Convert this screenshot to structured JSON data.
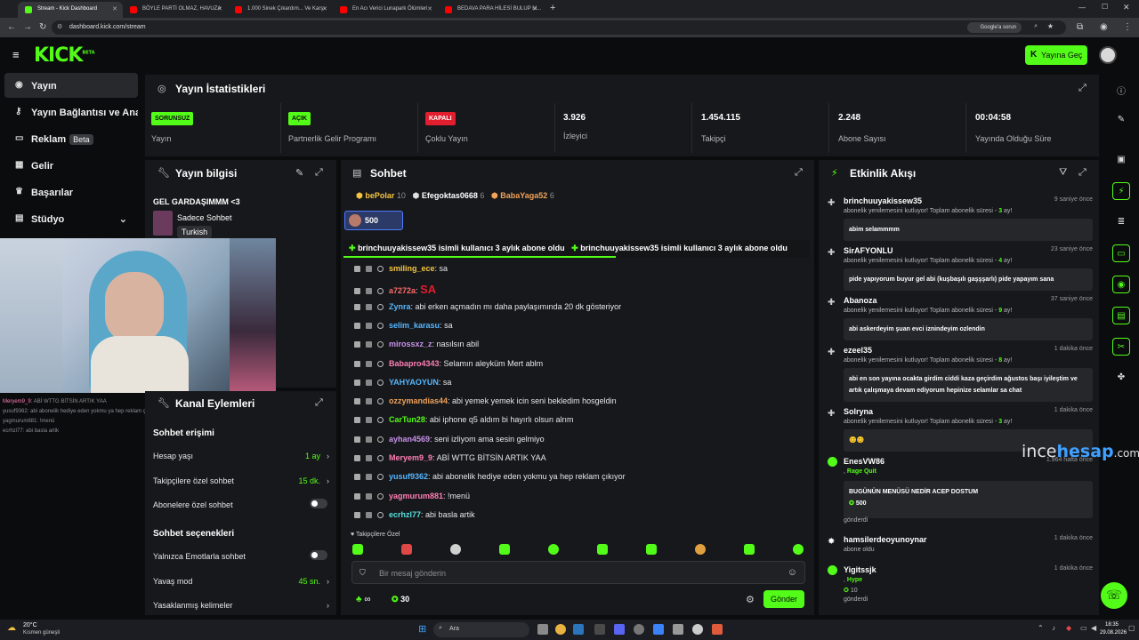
{
  "browser": {
    "tabs": [
      {
        "title": "Stream - Kick Dashboard",
        "active": true,
        "color": "#53fc18"
      },
      {
        "title": "BÖYLE PARTİ OLMAZ, HAVUZA",
        "active": false,
        "color": "#ff0000"
      },
      {
        "title": "1.000 Sinek Çıkardım... Ve Karşı",
        "active": false,
        "color": "#ff0000"
      },
      {
        "title": "En Acı Verici Lunapark Ölümleri",
        "active": false,
        "color": "#ff0000"
      },
      {
        "title": "BEDAVA PARA HİLESİ BULUP M...",
        "active": false,
        "color": "#ff0000"
      }
    ],
    "new_tab": "+",
    "url": "dashboard.kick.com/stream",
    "google_issue": "Google'a sorun"
  },
  "header": {
    "logo": "KICK",
    "logo_sup": "BETA",
    "go_live": "Yayına Geç"
  },
  "nav": {
    "items": [
      {
        "label": "Yayın",
        "icon": "broadcast-icon",
        "active": true
      },
      {
        "label": "Yayın Bağlantısı ve Anahtarı",
        "icon": "key-icon"
      },
      {
        "label": "Reklam",
        "icon": "ad-icon",
        "badge": "Beta"
      },
      {
        "label": "Gelir",
        "icon": "revenue-icon"
      },
      {
        "label": "Başarılar",
        "icon": "trophy-icon"
      },
      {
        "label": "Stüdyo",
        "icon": "studio-icon"
      }
    ]
  },
  "stats": {
    "title": "Yayın İstatistikleri",
    "items": [
      {
        "badge": "SORUNSUZ",
        "badge_color": "#53fc18",
        "label": "Yayın"
      },
      {
        "badge": "AÇIK",
        "badge_color": "#53fc18",
        "label": "Partnerlik Gelir Programı"
      },
      {
        "badge": "KAPALI",
        "badge_color": "#e01e2d",
        "label": "Çoklu Yayın"
      },
      {
        "value": "3.926",
        "label": "İzleyici"
      },
      {
        "value": "1.454.115",
        "label": "Takipçi"
      },
      {
        "value": "2.248",
        "label": "Abone Sayısı"
      },
      {
        "value": "00:04:58",
        "label": "Yayında Olduğu Süre"
      }
    ]
  },
  "stream_info": {
    "title": "Yayın bilgisi",
    "stream_title": "GEL GARDAŞIMMM <3",
    "category": "Sadece Sohbet",
    "language": "Turkish"
  },
  "overlay_chat": [
    {
      "user": "Meryem9_9",
      "text": "ABİ WTTG BİTSİN ARTIK YAA"
    },
    {
      "user": "yusuf9362",
      "text": "abi abonelik hediye eden yokmu ya hep reklam çıkıyor"
    },
    {
      "user": "yagmurum881",
      "text": "!menü"
    },
    {
      "user": "ecrhzl77",
      "text": "abi basla artik"
    }
  ],
  "channel_actions": {
    "title": "Kanal Eylemleri",
    "access_title": "Sohbet erişimi",
    "account_age": {
      "label": "Hesap yaşı",
      "value": "1 ay"
    },
    "followers_only": {
      "label": "Takipçilere özel sohbet",
      "value": "15 dk."
    },
    "subs_only": {
      "label": "Abonelere özel sohbet"
    },
    "options_title": "Sohbet seçenekleri",
    "emote_only": {
      "label": "Yalnızca Emotlarla sohbet"
    },
    "slow_mode": {
      "label": "Yavaş mod",
      "value": "45 sn."
    },
    "banned_words": {
      "label": "Yasaklanmış kelimeler"
    }
  },
  "chat": {
    "title": "Sohbet",
    "top_gifters": [
      {
        "name": "bePolar",
        "count": "10",
        "color": "#f5c542"
      },
      {
        "name": "Efegoktas0668",
        "count": "6",
        "color": "#e0e0e0"
      },
      {
        "name": "BabaYaga52",
        "count": "6",
        "color": "#f0a35a"
      }
    ],
    "pinned_amount": "500",
    "sub_banner": "brinchuuyakissew35 isimli kullanıcı 3 aylık abone oldu",
    "messages": [
      {
        "user": "smiling_ece",
        "color": "#f5c542",
        "text": "sa"
      },
      {
        "user": "a7272a",
        "color": "#ff6b6b",
        "text": "SA",
        "emote": true
      },
      {
        "user": "Zynra",
        "color": "#56b6ff",
        "text": "abi erken açmadın mı daha paylaşımında 20 dk gösteriyor"
      },
      {
        "user": "selim_karasu",
        "color": "#56b6ff",
        "text": "sa"
      },
      {
        "user": "mirossxz_z",
        "color": "#c792ea",
        "text": "nasılsın abil"
      },
      {
        "user": "Babapro4343",
        "color": "#ff7eb6",
        "text": "Selamın aleyküm Mert ablm"
      },
      {
        "user": "YAHYAOYUN",
        "color": "#56b6ff",
        "text": "sa"
      },
      {
        "user": "ozzymandias44",
        "color": "#f0a35a",
        "text": "abi yemek yemek icin seni bekledim hosgeldin"
      },
      {
        "user": "CarTun28",
        "color": "#53fc18",
        "text": "abi iphone q5 aldım bi hayırlı olsun alrım"
      },
      {
        "user": "ayhan4569",
        "color": "#c792ea",
        "text": "seni izliyom ama sesin gelmiyo"
      },
      {
        "user": "Meryem9_9",
        "color": "#ff7eb6",
        "text": "ABİ WTTG BİTSİN ARTIK YAA"
      },
      {
        "user": "yusuf9362",
        "color": "#56b6ff",
        "text": "abi abonelik hediye eden yokmu ya hep reklam çıkıyor"
      },
      {
        "user": "yagmurum881",
        "color": "#ff7eb6",
        "text": "!menü"
      },
      {
        "user": "ecrhzl77",
        "color": "#56e0e0",
        "text": "abi basla artik"
      }
    ],
    "followers_tag": "Takipçilere Özel",
    "input_placeholder": "Bir mesaj gönderin",
    "infinity": "∞",
    "points": "30",
    "send": "Gönder"
  },
  "activity": {
    "title": "Etkinlik Akışı",
    "items": [
      {
        "name": "brinchuuyakissew35",
        "time": "9 saniye önce",
        "sub_pre": "abonelik yenilemesini kutluyor! Toplam abonelik süresi - ",
        "sub_val": "3",
        "sub_post": " ay!",
        "msg": "abim selammmm"
      },
      {
        "name": "SirAFYONLU",
        "time": "23 saniye önce",
        "sub_pre": "abonelik yenilemesini kutluyor! Toplam abonelik süresi - ",
        "sub_val": "4",
        "sub_post": " ay!",
        "msg": "pide yapıyorum buyur gel abi (kuşbaşılı gaşşşarlı) pide yapayım sana"
      },
      {
        "name": "Abanoza",
        "time": "37 saniye önce",
        "sub_pre": "abonelik yenilemesini kutluyor! Toplam abonelik süresi - ",
        "sub_val": "9",
        "sub_post": " ay!",
        "msg": "abi askerdeyim şuan evci iznindeyim ozlendin"
      },
      {
        "name": "ezeel35",
        "time": "1 dakika önce",
        "sub_pre": "abonelik yenilemesini kutluyor! Toplam abonelik süresi - ",
        "sub_val": "8",
        "sub_post": " ay!",
        "msg": "abi en son yayına ocakta girdim ciddi kaza geçirdim ağustos başı iyileştim ve artık çalışmaya devam ediyorum hepinize selamlar sa chat"
      },
      {
        "name": "Solryna",
        "time": "1 dakika önce",
        "sub_pre": "abonelik yenilemesini kutluyor! Toplam abonelik süresi - ",
        "sub_val": "3",
        "sub_post": " ay!",
        "msg": "😊😊"
      },
      {
        "name": "EnesVW86",
        "time": "1.964 hafta önce",
        "reward": "Rage Quit",
        "msg": "BUGÜNÜN MENÜSÜ NEDİR ACEP DOSTUM",
        "amount": "500",
        "sent": "gönderdi"
      },
      {
        "name": "hamsilerdeoyunoynar",
        "time": "1 dakika önce",
        "sub_text": "abone oldu"
      },
      {
        "name": "Yigitssjk",
        "time": "1 dakika önce",
        "reward": "Hype",
        "amount": "10",
        "sent": "gönderdi"
      }
    ]
  },
  "watermark": {
    "a": "ince",
    "b": "hesap",
    "c": ".com"
  },
  "taskbar": {
    "weather_temp": "20°C",
    "weather_desc": "Kısmen güneşli",
    "search": "Ara",
    "time": "18:35",
    "date": "29.08.2026"
  }
}
